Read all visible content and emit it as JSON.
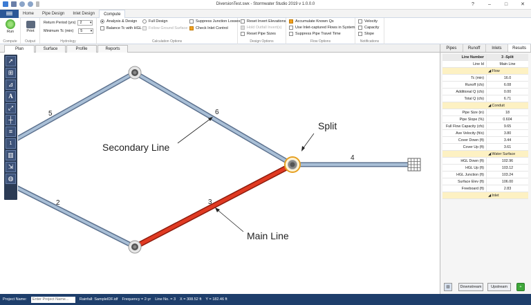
{
  "app": {
    "title": "DiversionTest.swx - Stormwater Studio 2019 v 1.0.0.0"
  },
  "menu": {
    "file": "File",
    "tabs": [
      "Home",
      "Pipe Design",
      "Inlet Design",
      "Compute"
    ],
    "active": 3
  },
  "ribbon": {
    "run_label": "Run",
    "print_label": "Print",
    "compute_group": "Compute",
    "output_group": "Output",
    "return_period_label": "Return Period (yrs)",
    "return_period_value": "2",
    "min_tc_label": "Minimum Tc (min)",
    "min_tc_value": "5",
    "hydrology_group": "Hydrology",
    "analysis_design": "Analysis & Design",
    "full_design": "Full Design",
    "balance_tc": "Balance Tc with HGL",
    "follow_ground": "Follow Ground Surface",
    "suppress_junction": "Suppress Junction Losses",
    "check_inlet": "Check Inlet Control",
    "calc_group": "Calculation Options",
    "reset_invert": "Reset Invert Elevations",
    "hold_outfall": "Hold Outfall Invert(s)",
    "reset_pipe": "Reset Pipe Sizes",
    "design_group": "Design Options",
    "accumulate": "Accumulate Known Qs",
    "use_inlet": "Use Inlet-captured Flows in System",
    "suppress_travel": "Suppress Pipe Travel Time",
    "flow_group": "Flow Options",
    "velocity": "Velocity",
    "capacity": "Capacity",
    "slope": "Slope",
    "notif_group": "Notifications"
  },
  "view_tabs": [
    "Plan",
    "Surface",
    "Profile",
    "Reports"
  ],
  "canvas": {
    "labels": {
      "line5": "5",
      "line6": "6",
      "line2": "2",
      "line3": "3",
      "line4": "4"
    },
    "annotations": {
      "secondary": "Secondary Line",
      "main": "Main Line",
      "split": "Split"
    }
  },
  "panel": {
    "tabs": [
      "Pipes",
      "Runoff",
      "Inlets",
      "Results"
    ],
    "active": 3,
    "header": {
      "k": "Line Number",
      "v": "3 -Split"
    },
    "line_id": {
      "k": "Line Id",
      "v": "Main Line"
    },
    "flow_section": "Flow",
    "flow": [
      {
        "k": "Tc (min)",
        "v": "16.0"
      },
      {
        "k": "Runoff (cfs)",
        "v": "6.08"
      },
      {
        "k": "Additional Q (cfs)",
        "v": "0.00"
      },
      {
        "k": "Total Q (cfs)",
        "v": "6.71"
      }
    ],
    "conduit_section": "Conduit",
    "conduit": [
      {
        "k": "Pipe Size (in)",
        "v": "18"
      },
      {
        "k": "Pipe Slope (%)",
        "v": "0.604"
      },
      {
        "k": "Full Flow Capacity (cfs)",
        "v": "9.65"
      },
      {
        "k": "Ave Velocity (ft/s)",
        "v": "3.80"
      },
      {
        "k": "Cover Down (ft)",
        "v": "3.44"
      },
      {
        "k": "Cover Up (ft)",
        "v": "3.61"
      }
    ],
    "water_section": "Water Surface",
    "water": [
      {
        "k": "HGL Down (ft)",
        "v": "102.96"
      },
      {
        "k": "HGL Up (ft)",
        "v": "103.12"
      },
      {
        "k": "HGL Junction (ft)",
        "v": "103.24"
      },
      {
        "k": "Surface Elev (ft)",
        "v": "106.00"
      },
      {
        "k": "Freeboard (ft)",
        "v": "2.83"
      }
    ],
    "inlet_section": "Inlet",
    "downstream": "Downstream",
    "upstream": "Upstream"
  },
  "status": {
    "project_label": "Project Name:",
    "project_placeholder": "Enter Project Name...",
    "rainfall": "Rainfall: SampleIDF.idf",
    "frequency": "Frequency = 2-yr",
    "line_no": "Line No. = 3",
    "x": "X = 308.52 ft",
    "y": "Y = 182.46 ft"
  },
  "colors": {
    "accent": "#2b5797",
    "main_line": "#e03a22",
    "pipe": "#9bb3cc",
    "status": "#1e3e6b"
  }
}
